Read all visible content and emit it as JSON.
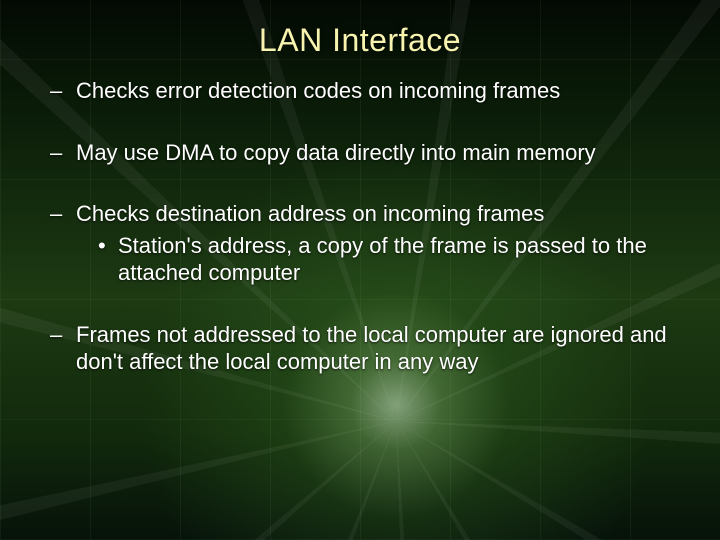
{
  "slide": {
    "title": "LAN Interface",
    "bullets": [
      {
        "text": "Checks error detection codes on incoming frames"
      },
      {
        "text": "May use DMA to copy data directly into main memory"
      },
      {
        "text": "Checks destination address on incoming frames",
        "sub": [
          "Station's address, a copy of the frame is passed to the attached computer"
        ]
      },
      {
        "text": "Frames not addressed to the local computer are ignored and don't affect the local computer in any way"
      }
    ]
  }
}
